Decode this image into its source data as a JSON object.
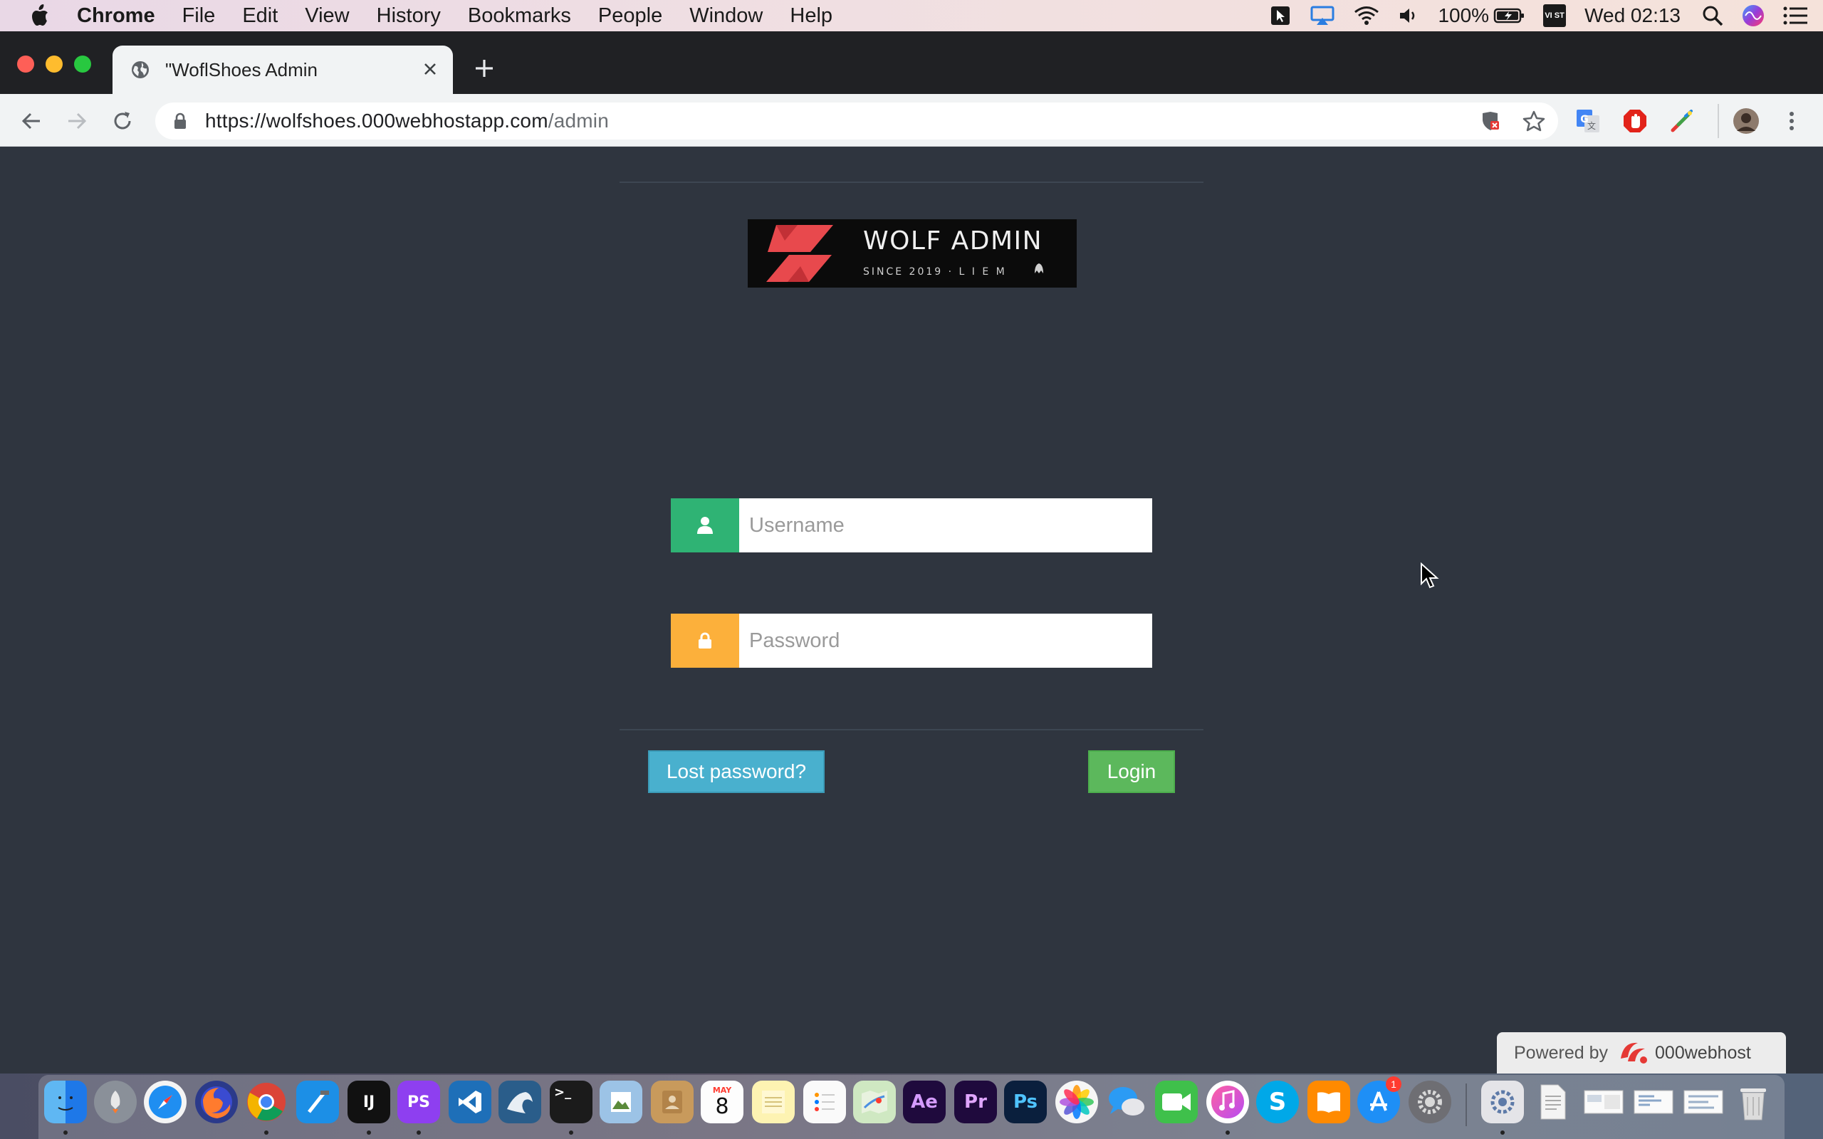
{
  "menubar": {
    "app_name": "Chrome",
    "items": [
      "File",
      "Edit",
      "View",
      "History",
      "Bookmarks",
      "People",
      "Window",
      "Help"
    ],
    "battery": "100%",
    "input_source": "VI ST",
    "clock": "Wed 02:13"
  },
  "browser": {
    "tab_title": "\"WoflShoes Admin",
    "url_host": "https://wolfshoes.000webhostapp.com",
    "url_path": "/admin"
  },
  "login": {
    "logo_title": "WOLF ADMIN",
    "logo_subtitle": "SINCE 2019 · L I E M",
    "username_placeholder": "Username",
    "password_placeholder": "Password",
    "lost_password_label": "Lost password?",
    "login_label": "Login"
  },
  "footer": {
    "powered_label": "Powered by",
    "powered_brand": "000webhost"
  },
  "dock": {
    "calendar_month": "MAY",
    "calendar_day": "8",
    "app_store_badge": "1",
    "apps": [
      "Finder",
      "Launchpad",
      "Safari",
      "Firefox",
      "Chrome",
      "Xcode",
      "IntelliJ IDEA",
      "PhpStorm",
      "Visual Studio Code",
      "MySQL Workbench",
      "Terminal",
      "Preview",
      "Contacts",
      "Calendar",
      "Notes",
      "Reminders",
      "Maps",
      "After Effects",
      "Premiere Pro",
      "Photoshop",
      "Photos",
      "Messages",
      "FaceTime",
      "iTunes",
      "Skype",
      "Books",
      "App Store",
      "System Preferences"
    ]
  },
  "colors": {
    "page_bg": "#2f353f",
    "username_addon": "#2fb374",
    "password_addon": "#fcb03b",
    "lost_password_btn": "#49b0ce",
    "login_btn": "#5cb85c",
    "logo_accent": "#e8494d"
  }
}
